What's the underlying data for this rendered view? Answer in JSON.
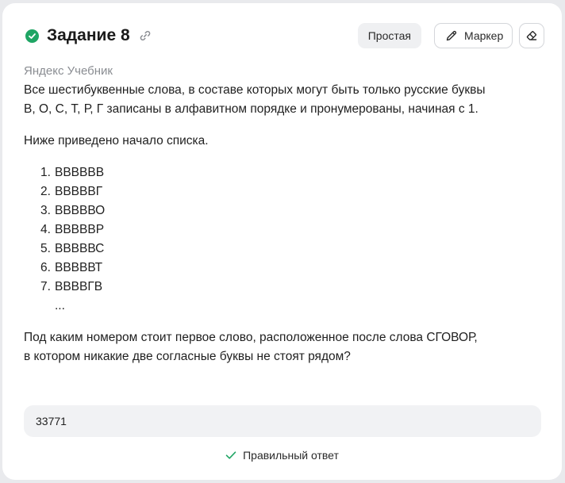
{
  "task": {
    "title": "Задание 8",
    "difficulty": "Простая",
    "marker_label": "Маркер",
    "status": "solved",
    "status_color": "#1fa564"
  },
  "icons": {
    "status": "check-circle-icon",
    "link": "link-icon",
    "marker": "pencil-icon",
    "eraser": "eraser-icon",
    "result": "checkmark-icon"
  },
  "source": "Яндекс Учебник",
  "body": {
    "line1": "Все шестибуквенные слова, в составе которых могут быть только русские буквы",
    "line2": "В, О, С, Т, Р, Г записаны в алфавитном порядке и пронумерованы, начиная с 1.",
    "intro": "Ниже приведено начало списка.",
    "list": [
      {
        "num": "1.",
        "word": "ВВВВВВ"
      },
      {
        "num": "2.",
        "word": "ВВВВВГ"
      },
      {
        "num": "3.",
        "word": "ВВВВВО"
      },
      {
        "num": "4.",
        "word": "ВВВВВР"
      },
      {
        "num": "5.",
        "word": "ВВВВВС"
      },
      {
        "num": "6.",
        "word": "ВВВВВТ"
      },
      {
        "num": "7.",
        "word": "ВВВВГВ"
      }
    ],
    "ellipsis": "...",
    "question1": "Под каким номером стоит первое слово, расположенное после слова СГОВОР,",
    "question2": "в котором никакие две согласные буквы не стоят рядом?"
  },
  "answer": {
    "value": "33771"
  },
  "result": {
    "label": "Правильный ответ",
    "color": "#1fa564"
  }
}
